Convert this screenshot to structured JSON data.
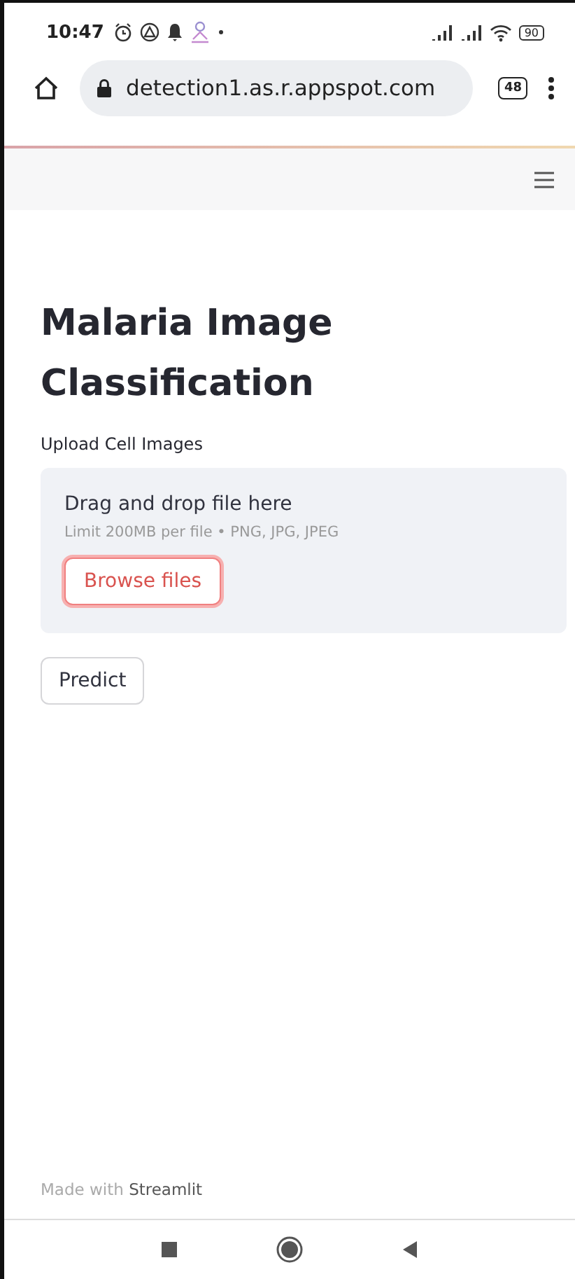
{
  "status_bar": {
    "time": "10:47",
    "battery": "90"
  },
  "browser": {
    "url": "detection1.as.r.appspot.com",
    "tab_count": "48"
  },
  "page": {
    "title": "Malaria Image Classification",
    "uploader": {
      "label": "Upload Cell Images",
      "prompt": "Drag and drop file here",
      "limits": "Limit 200MB per file • PNG, JPG, JPEG",
      "button": "Browse files",
      "focused": true
    },
    "predict_button": "Predict"
  },
  "footer": {
    "prefix": "Made with",
    "link": "Streamlit"
  }
}
